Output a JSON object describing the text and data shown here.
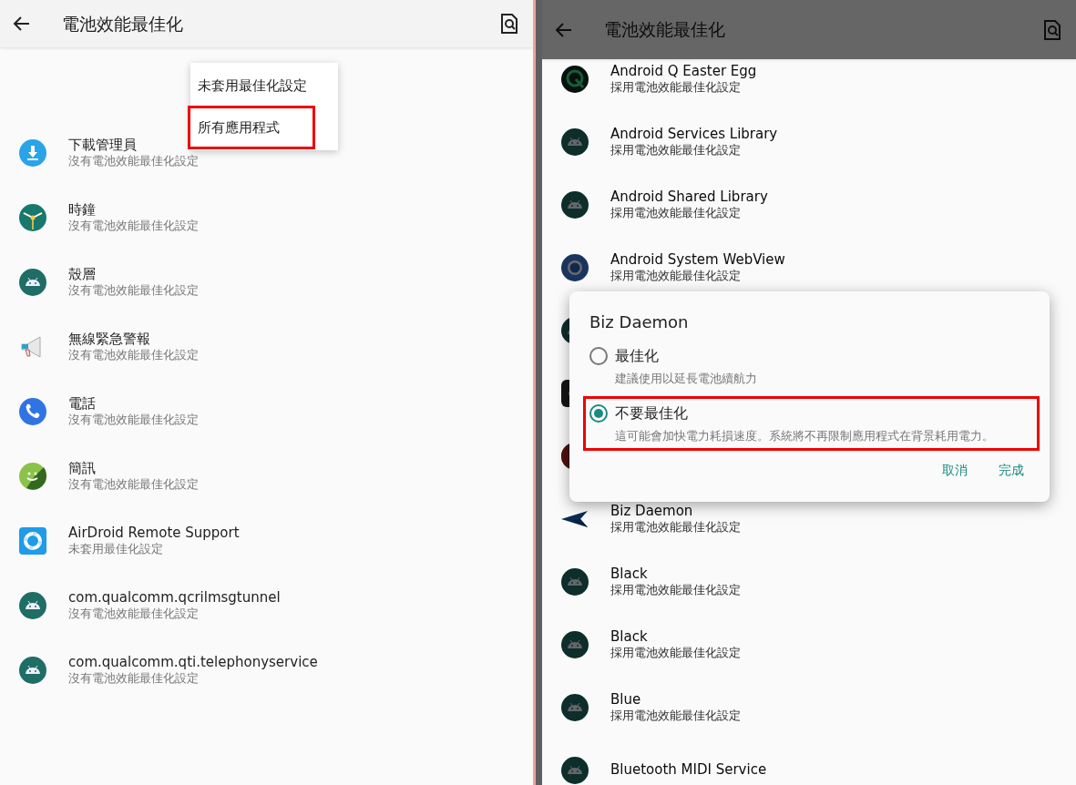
{
  "left_screen": {
    "title": "電池效能最佳化",
    "apps": [
      {
        "kind": "download",
        "name": "下載管理員",
        "status": "沒有電池效能最佳化設定"
      },
      {
        "kind": "clock",
        "name": "時鐘",
        "status": "沒有電池效能最佳化設定"
      },
      {
        "kind": "android",
        "name": "殼層",
        "status": "沒有電池效能最佳化設定"
      },
      {
        "kind": "megaphone",
        "name": "無線緊急警報",
        "status": "沒有電池效能最佳化設定"
      },
      {
        "kind": "phone",
        "name": "電話",
        "status": "沒有電池效能最佳化設定"
      },
      {
        "kind": "messages",
        "name": "簡訊",
        "status": "沒有電池效能最佳化設定"
      },
      {
        "kind": "airdroid",
        "name": "AirDroid Remote Support",
        "status": "未套用最佳化設定"
      },
      {
        "kind": "android",
        "name": "com.qualcomm.qcrilmsgtunnel",
        "status": "沒有電池效能最佳化設定"
      },
      {
        "kind": "android",
        "name": "com.qualcomm.qti.telephonyservice",
        "status": "沒有電池效能最佳化設定"
      }
    ],
    "menu": [
      {
        "label": "未套用最佳化設定",
        "highlighted": false
      },
      {
        "label": "所有應用程式",
        "highlighted": true
      }
    ]
  },
  "right_screen": {
    "title": "電池效能最佳化",
    "apps": [
      {
        "kind": "q-egg",
        "name": "Android Q Easter Egg",
        "status": "採用電池效能最佳化設定"
      },
      {
        "kind": "android",
        "name": "Android Services Library",
        "status": "採用電池效能最佳化設定"
      },
      {
        "kind": "android",
        "name": "Android Shared Library",
        "status": "採用電池效能最佳化設定"
      },
      {
        "kind": "webview",
        "name": "Android System WebView",
        "status": "採用電池效能最佳化設定"
      },
      {
        "kind": "android"
      },
      {
        "kind": "dark-square"
      },
      {
        "kind": "dark-circle"
      },
      {
        "kind": "paper-plane",
        "name": "Biz Daemon",
        "status": "採用電池效能最佳化設定"
      },
      {
        "kind": "android",
        "name": "Black",
        "status": "採用電池效能最佳化設定"
      },
      {
        "kind": "android",
        "name": "Black",
        "status": "採用電池效能最佳化設定"
      },
      {
        "kind": "android",
        "name": "Blue",
        "status": "採用電池效能最佳化設定"
      },
      {
        "kind": "android",
        "name": "Bluetooth MIDI Service"
      }
    ],
    "dialog": {
      "title": "Biz Daemon",
      "options": [
        {
          "label": "最佳化",
          "description": "建議使用以延長電池續航力",
          "selected": false,
          "highlighted": false
        },
        {
          "label": "不要最佳化",
          "description": "這可能會加快電力耗損速度。系統將不再限制應用程式在背景耗用電力。",
          "selected": true,
          "highlighted": true
        }
      ],
      "buttons": [
        "取消",
        "完成"
      ]
    }
  }
}
